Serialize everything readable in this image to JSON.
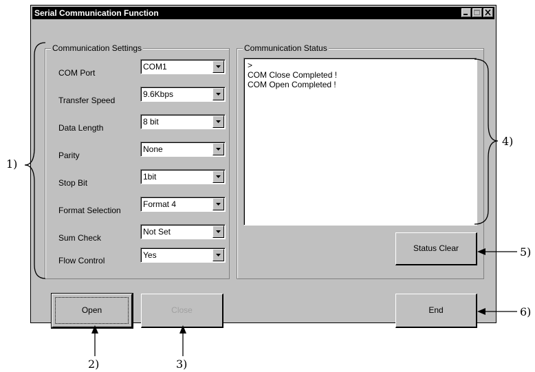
{
  "window": {
    "title": "Serial Communication Function"
  },
  "settings": {
    "group_title": "Communication Settings",
    "fields": [
      {
        "label": "COM Port",
        "value": "COM1"
      },
      {
        "label": "Transfer Speed",
        "value": "9.6Kbps"
      },
      {
        "label": "Data Length",
        "value": "8 bit"
      },
      {
        "label": "Parity",
        "value": "None"
      },
      {
        "label": "Stop Bit",
        "value": "1bit"
      },
      {
        "label": "Format Selection",
        "value": "Format 4"
      },
      {
        "label": "Sum Check",
        "value": "Not Set"
      },
      {
        "label": "Flow Control",
        "value": "Yes"
      }
    ]
  },
  "status": {
    "group_title": "Communication Status",
    "lines": [
      ">",
      "COM Close Completed !",
      "COM Open Completed !"
    ]
  },
  "buttons": {
    "status_clear": "Status Clear",
    "open": "Open",
    "close": "Close",
    "end": "End"
  },
  "annotations": {
    "a1": "1)",
    "a2": "2)",
    "a3": "3)",
    "a4": "4)",
    "a5": "5)",
    "a6": "6)"
  }
}
